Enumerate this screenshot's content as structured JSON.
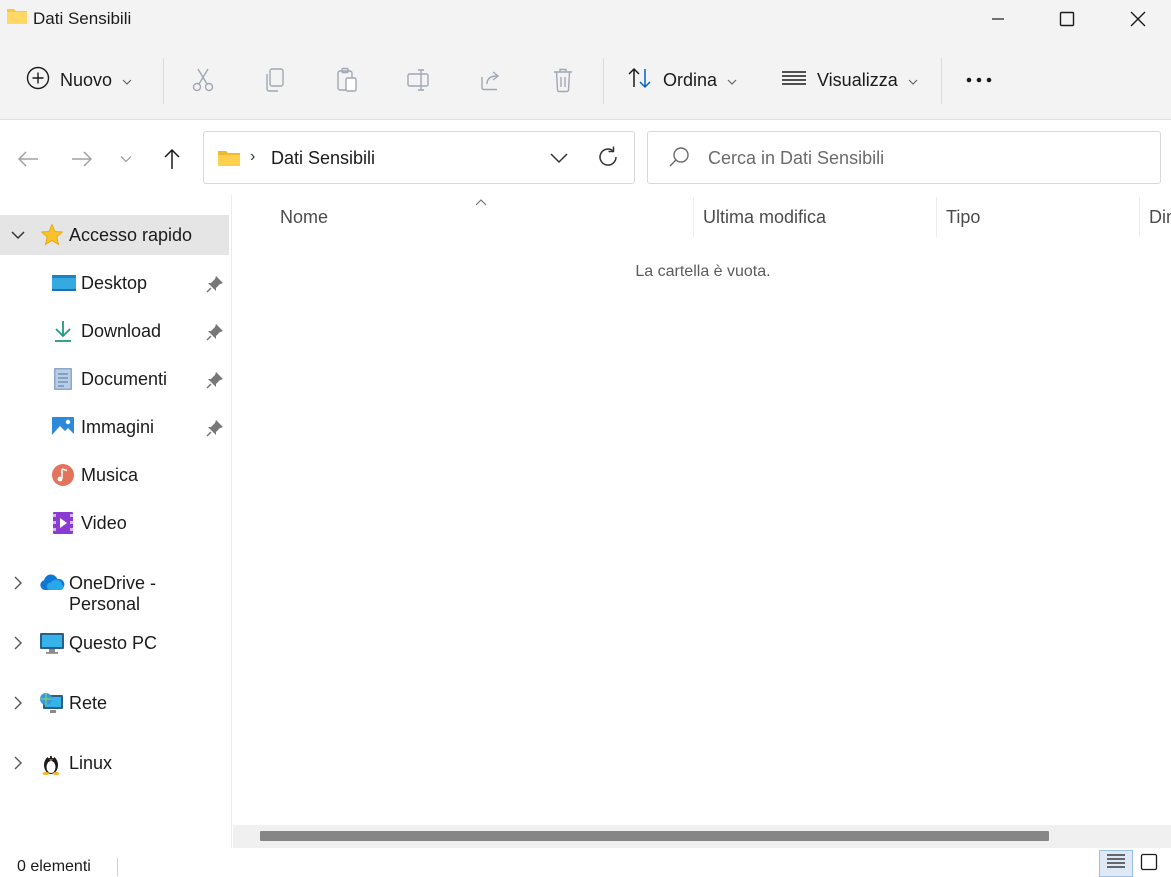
{
  "window": {
    "title": "Dati Sensibili"
  },
  "commandbar": {
    "new_label": "Nuovo",
    "sort_label": "Ordina",
    "view_label": "Visualizza",
    "icons": [
      "cut-icon",
      "copy-icon",
      "paste-icon",
      "rename-icon",
      "share-icon",
      "delete-icon",
      "more-icon"
    ]
  },
  "address": {
    "path": "Dati Sensibili",
    "separator": "›"
  },
  "search": {
    "placeholder": "Cerca in Dati Sensibili"
  },
  "sidebar": {
    "quick_access": "Accesso rapido",
    "items": [
      {
        "label": "Desktop",
        "pinned": true
      },
      {
        "label": "Download",
        "pinned": true
      },
      {
        "label": "Documenti",
        "pinned": true
      },
      {
        "label": "Immagini",
        "pinned": true
      },
      {
        "label": "Musica",
        "pinned": false
      },
      {
        "label": "Video",
        "pinned": false
      }
    ],
    "roots": [
      {
        "label": "OneDrive - Personal"
      },
      {
        "label": "Questo PC"
      },
      {
        "label": "Rete"
      },
      {
        "label": "Linux"
      }
    ]
  },
  "columns": {
    "name": "Nome",
    "modified": "Ultima modifica",
    "type": "Tipo",
    "size": "Dim"
  },
  "content": {
    "empty_message": "La cartella è vuota."
  },
  "status": {
    "count": "0 elementi"
  },
  "colors": {
    "chrome_bg": "#f3f3f3",
    "selection_bg": "#e5e5e5",
    "folder_yellow": "#f8c847",
    "accent_blue": "#0067c0"
  }
}
